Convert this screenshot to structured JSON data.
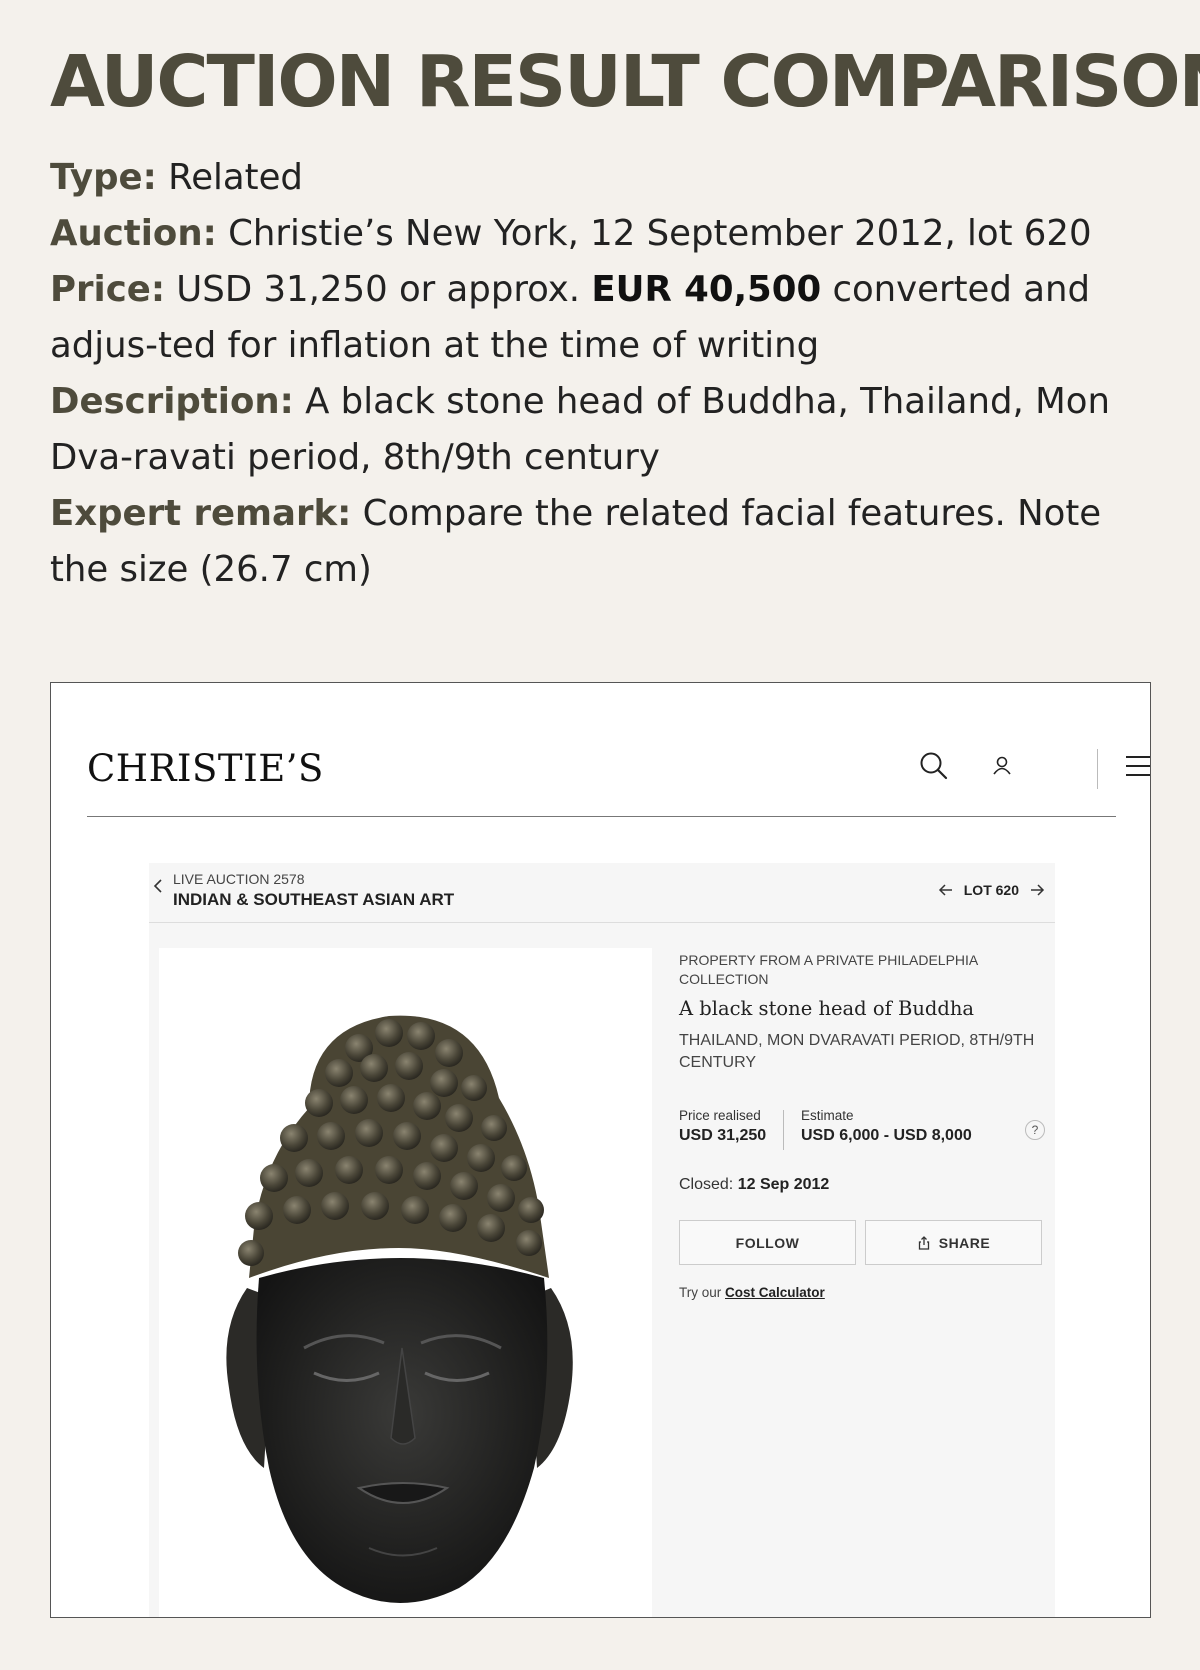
{
  "heading": "AUCTION RESULT COMPARISON",
  "info": {
    "type_label": "Type:",
    "type_value": " Related",
    "auction_label": "Auction:",
    "auction_value": " Christie’s New York, 12 September 2012, lot 620",
    "price_label": "Price:",
    "price_prefix": " USD 31,250 or approx. ",
    "price_bold": "EUR 40,500",
    "price_suffix": " converted and adjus-ted for inflation at the time of writing",
    "description_label": "Description:",
    "description_value": " A black stone head of Buddha, Thailand, Mon Dva-ravati period, 8th/9th century",
    "remark_label": "Expert remark:",
    "remark_value": " Compare the related facial features. Note the size (26.7 cm)"
  },
  "site": {
    "logo": "CHRISTIE’S",
    "icons": [
      "search-icon",
      "user-icon",
      "menu-icon"
    ]
  },
  "lot_bar": {
    "live_label": "LIVE AUCTION 2578",
    "sale_title": "INDIAN & SOUTHEAST ASIAN ART",
    "lot_number": "LOT 620"
  },
  "lot": {
    "provenance": "PROPERTY FROM A PRIVATE PHILADELPHIA COLLECTION",
    "title": "A black stone head of Buddha",
    "subtitle": "THAILAND, MON DVARAVATI PERIOD, 8TH/9TH CENTURY",
    "price_realised_label": "Price realised",
    "price_realised_value": "USD 31,250",
    "estimate_label": "Estimate",
    "estimate_value": "USD 6,000 - USD 8,000",
    "help": "?",
    "closed_label": "Closed: ",
    "closed_date": "12 Sep 2012",
    "follow_label": "FOLLOW",
    "share_label": "SHARE",
    "calc_prefix": "Try our ",
    "calc_link": "Cost Calculator"
  }
}
